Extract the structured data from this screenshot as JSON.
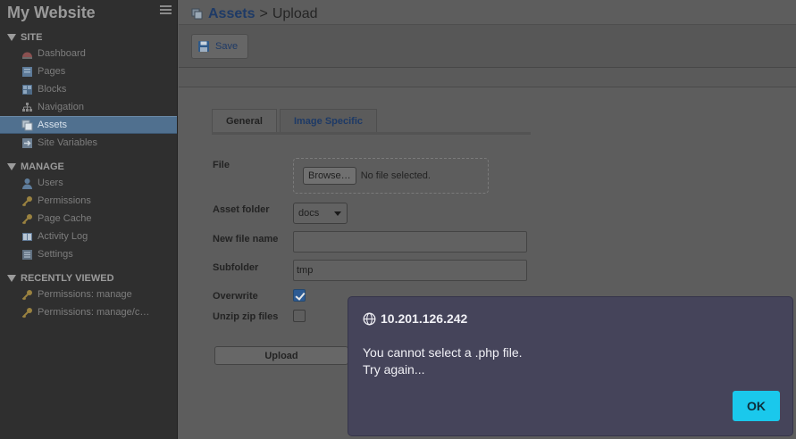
{
  "sidebar": {
    "site_title": "My Website",
    "sections": [
      {
        "heading": "SITE",
        "items": [
          {
            "label": "Dashboard",
            "icon": "dashboard-icon"
          },
          {
            "label": "Pages",
            "icon": "pages-icon"
          },
          {
            "label": "Blocks",
            "icon": "blocks-icon"
          },
          {
            "label": "Navigation",
            "icon": "navigation-icon"
          },
          {
            "label": "Assets",
            "icon": "assets-icon",
            "active": true
          },
          {
            "label": "Site Variables",
            "icon": "site-variables-icon"
          }
        ]
      },
      {
        "heading": "MANAGE",
        "items": [
          {
            "label": "Users",
            "icon": "user-icon"
          },
          {
            "label": "Permissions",
            "icon": "key-icon"
          },
          {
            "label": "Page Cache",
            "icon": "key-icon"
          },
          {
            "label": "Activity Log",
            "icon": "book-icon"
          },
          {
            "label": "Settings",
            "icon": "settings-icon"
          }
        ]
      },
      {
        "heading": "RECENTLY VIEWED",
        "items": [
          {
            "label": "Permissions: manage",
            "icon": "key-icon"
          },
          {
            "label": "Permissions: manage/c…",
            "icon": "key-icon"
          }
        ]
      }
    ]
  },
  "breadcrumb": {
    "parent": "Assets",
    "separator": ">",
    "current": "Upload"
  },
  "toolbar": {
    "save_label": "Save"
  },
  "tabs": [
    "General",
    "Image Specific"
  ],
  "form": {
    "file_label": "File",
    "browse_label": "Browse…",
    "no_file_text": "No file selected.",
    "asset_folder_label": "Asset folder",
    "asset_folder_value": "docs",
    "new_file_name_label": "New file name",
    "new_file_name_value": "",
    "subfolder_label": "Subfolder",
    "subfolder_value": "tmp",
    "overwrite_label": "Overwrite",
    "overwrite_checked": true,
    "unzip_label": "Unzip zip files",
    "unzip_checked": false,
    "upload_label": "Upload"
  },
  "dialog": {
    "origin": "10.201.126.242",
    "message_line1": "You cannot select a .php file.",
    "message_line2": "Try again...",
    "ok_label": "OK",
    "accent_color": "#1ac8ec"
  }
}
